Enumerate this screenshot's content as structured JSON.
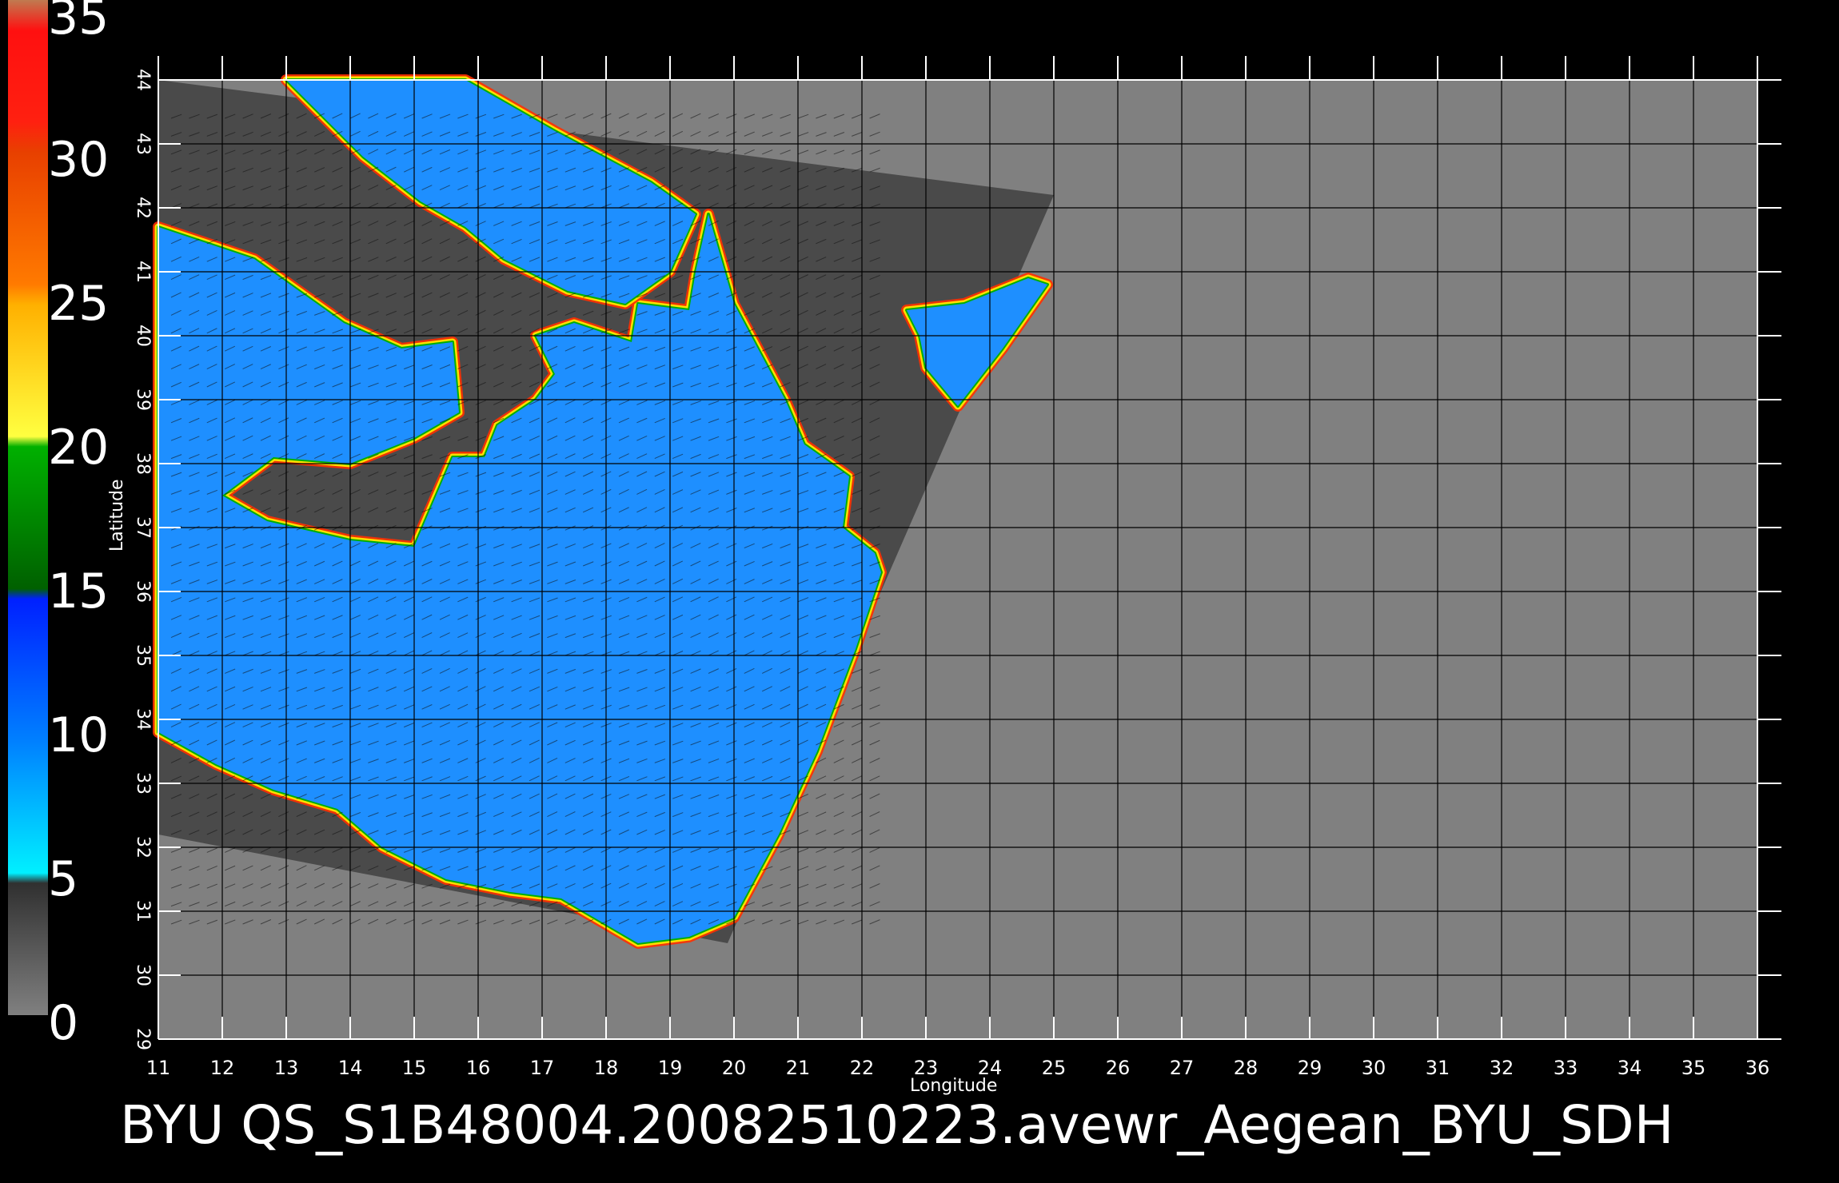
{
  "title": "BYU  QS_S1B48004.20082510223.avewr_Aegean_BYU_SDH",
  "axes": {
    "xlabel": "Longitude",
    "ylabel": "Latitude",
    "lon_ticks": [
      "11",
      "12",
      "13",
      "14",
      "15",
      "16",
      "17",
      "18",
      "19",
      "20",
      "21",
      "22",
      "23",
      "24",
      "25",
      "26",
      "27",
      "28",
      "29",
      "30",
      "31",
      "32",
      "33",
      "34",
      "35",
      "36"
    ],
    "lat_ticks": [
      "29",
      "30",
      "31",
      "32",
      "33",
      "34",
      "35",
      "36",
      "37",
      "38",
      "39",
      "40",
      "41",
      "42",
      "43",
      "44"
    ],
    "lon_range": [
      11,
      36
    ],
    "lat_range": [
      29,
      44
    ],
    "grid": true
  },
  "colorbar": {
    "labels": [
      "35",
      "30",
      "25",
      "20",
      "15",
      "10",
      "5",
      "0"
    ],
    "values": [
      35,
      30,
      25,
      20,
      15,
      10,
      5,
      0
    ],
    "range": [
      0,
      35
    ],
    "colors": [
      "#ff1010",
      "#ff6a00",
      "#ffd000",
      "#00b000",
      "#0040ff",
      "#00e8ff",
      "#404040",
      "#808080"
    ]
  },
  "map_colors": {
    "background": "#000000",
    "out_of_swath": "#808080",
    "land_in_swath": "#4a4a4a",
    "sea": "#1e8fff",
    "grid": "#000000"
  },
  "swath_corners_lonlat": [
    [
      11,
      44
    ],
    [
      25.0,
      42.2
    ],
    [
      19.9,
      30.5
    ],
    [
      11,
      32.2
    ]
  ]
}
